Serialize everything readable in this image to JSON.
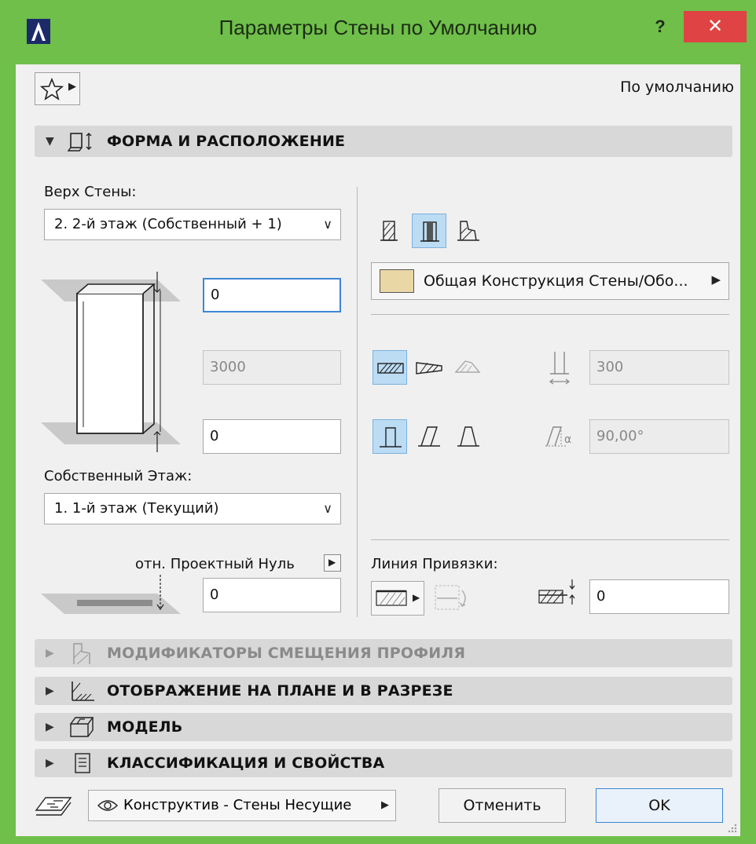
{
  "window": {
    "title": "Параметры Стены по Умолчанию",
    "help_label": "?",
    "close_label": "✕",
    "accent_color": "#6fbf4a"
  },
  "header": {
    "favorites_icon": "star-icon",
    "default_label": "По умолчанию"
  },
  "sections": {
    "shape": {
      "label": "ФОРМА И РАСПОЛОЖЕНИЕ",
      "expanded": true
    },
    "profile_modifiers": {
      "label": "МОДИФИКАТОРЫ СМЕЩЕНИЯ ПРОФИЛЯ",
      "enabled": false
    },
    "plan_section": {
      "label": "ОТОБРАЖЕНИЕ НА ПЛАНЕ И В РАЗРЕЗЕ"
    },
    "model": {
      "label": "МОДЕЛЬ"
    },
    "classification": {
      "label": "КЛАССИФИКАЦИЯ И СВОЙСТВА"
    }
  },
  "shape": {
    "top_label": "Верх Стены:",
    "top_value": "2. 2-й этаж (Собственный + 1)",
    "top_offset": "0",
    "height": "3000",
    "bottom_offset": "0",
    "home_story_label": "Собственный Этаж:",
    "home_story_value": "1. 1-й этаж (Текущий)",
    "ref_label": "отн. Проектный Нуль",
    "ref_value": "0",
    "structure_name": "Общая Конструкция Стены/Обо...",
    "thickness": "300",
    "angle": "90,00°",
    "ref_line_label": "Линия Привязки:",
    "ref_line_offset": "0"
  },
  "footer": {
    "layer": "Конструктив - Стены Несущие",
    "cancel": "Отменить",
    "ok": "OK"
  }
}
